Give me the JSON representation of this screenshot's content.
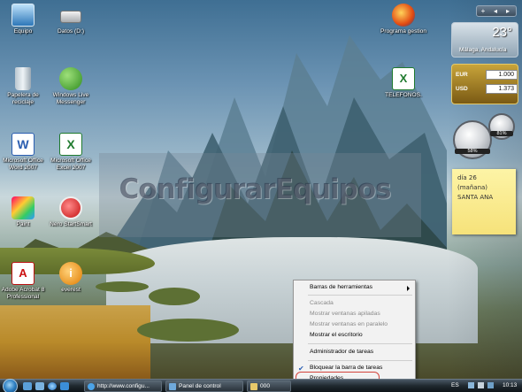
{
  "desktop_icons": [
    {
      "label": "Equipo"
    },
    {
      "label": "Datos (D:)"
    },
    {
      "label": "Papelera de reciclaje"
    },
    {
      "label": "Windows Live Messenger"
    },
    {
      "label": "Microsoft Office Word 2007"
    },
    {
      "label": "Microsoft Office Excel 2007"
    },
    {
      "label": "Paint"
    },
    {
      "label": "Nero StartSmart"
    },
    {
      "label": "Adobe Acrobat 8 Professional"
    },
    {
      "label": "everest"
    },
    {
      "label": "Programa gestion"
    },
    {
      "label": "TELEFONOS."
    }
  ],
  "watermark": "ConfigurarEquipos",
  "sidebar": {
    "top_controls": [
      "+",
      "◂",
      "▸"
    ],
    "weather": {
      "temp": "23°",
      "city": "Málaga, Andalucía"
    },
    "currency": [
      {
        "code": "EUR",
        "value": "1.000"
      },
      {
        "code": "USD",
        "value": "1.373"
      }
    ],
    "gauges": [
      "58%",
      "81%"
    ],
    "note": {
      "line1": "día 26",
      "line2": "(mañana)",
      "line3": "SANTA ANA"
    }
  },
  "context_menu": {
    "items": [
      {
        "label": "Barras de herramientas",
        "enabled": true
      },
      {
        "label": "Cascada",
        "enabled": false
      },
      {
        "label": "Mostrar ventanas apiladas",
        "enabled": false
      },
      {
        "label": "Mostrar ventanas en paralelo",
        "enabled": false
      },
      {
        "label": "Mostrar el escritorio",
        "enabled": true
      },
      {
        "label": "Administrador de tareas",
        "enabled": true
      },
      {
        "label": "Bloquear la barra de tareas",
        "enabled": true,
        "checked": true
      },
      {
        "label": "Propiedades",
        "enabled": true
      }
    ]
  },
  "taskbar": {
    "buttons": [
      {
        "label": "http://www.configu..."
      },
      {
        "label": "Panel de control"
      },
      {
        "label": "000"
      }
    ],
    "tray": {
      "lang": "ES",
      "time": "10:13"
    }
  },
  "colors": {
    "menu_bg": "#f2f2f2",
    "highlight_ring": "#d2443c",
    "note_yellow": "#fdf4a6"
  }
}
